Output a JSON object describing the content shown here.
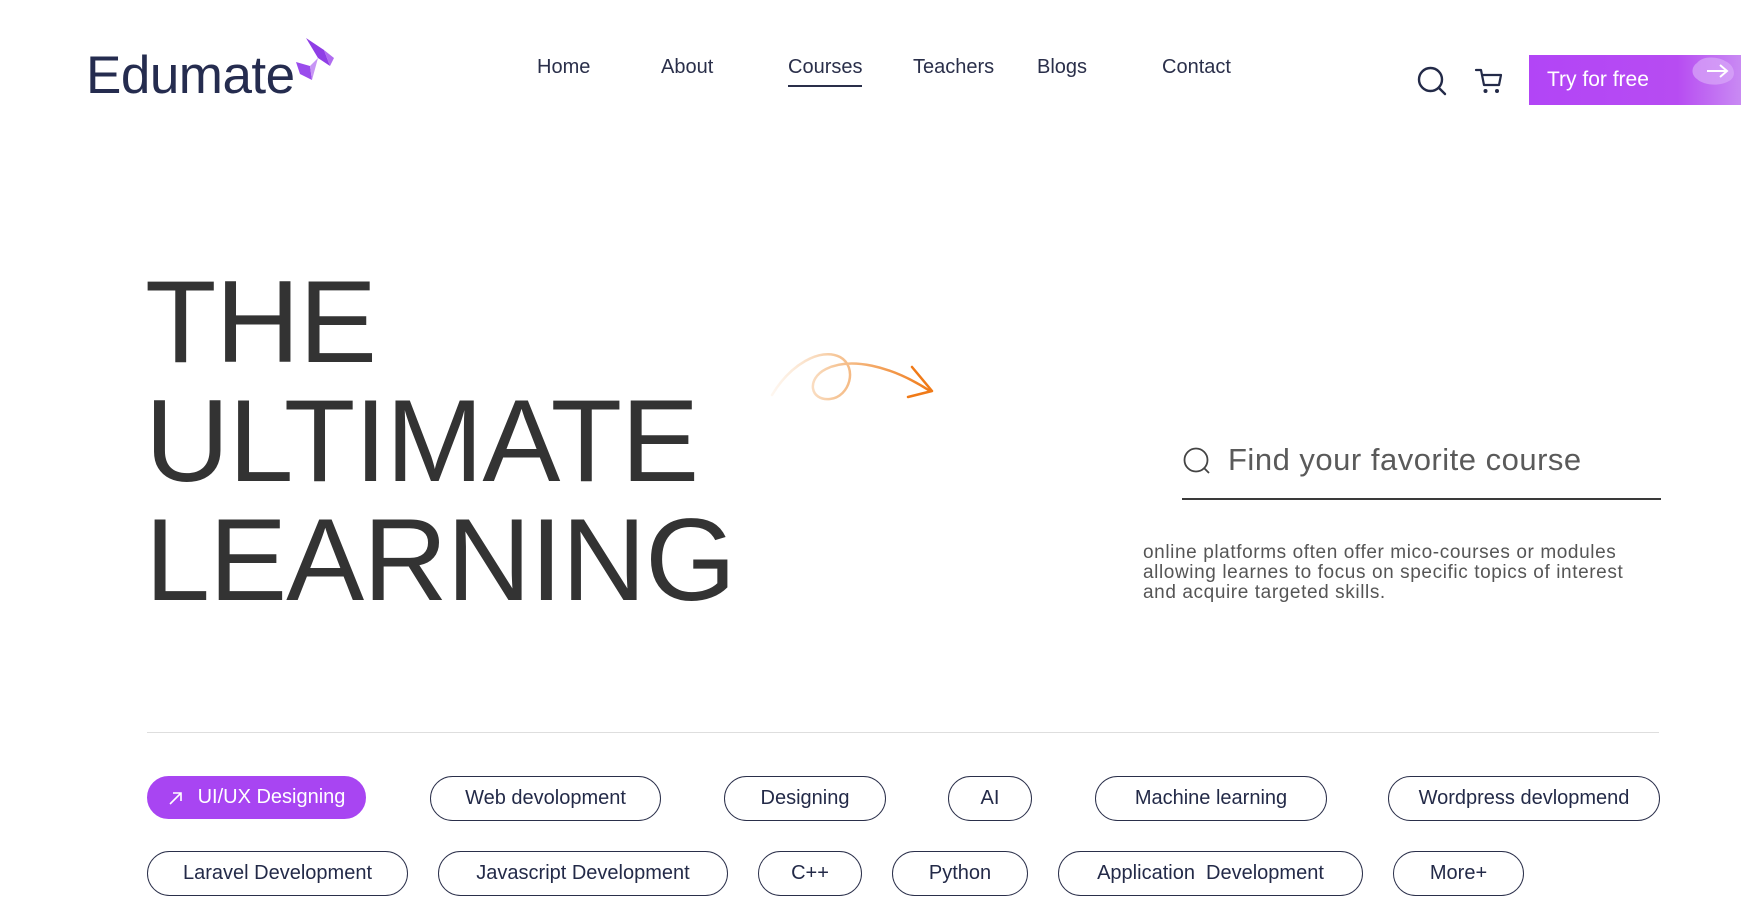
{
  "brand": {
    "name": "Edumate",
    "primary_color": "#a845f2",
    "accent_orange": "#f07a18",
    "text_color": "#252c4f"
  },
  "nav": {
    "items": [
      {
        "label": "Home"
      },
      {
        "label": "About"
      },
      {
        "label": "Courses",
        "active": true
      },
      {
        "label": "Teachers"
      },
      {
        "label": "Blogs"
      },
      {
        "label": "Contact"
      }
    ]
  },
  "header_actions": {
    "search_icon": "search-icon",
    "cart_icon": "cart-icon",
    "cta_label": "Try for free",
    "cta_icon": "arrow-right-icon"
  },
  "hero": {
    "title_lines": [
      "THE",
      "ULTIMATE",
      "LEARNING"
    ],
    "decoration_icon": "swirl-arrow-icon",
    "search_placeholder": "Find your favorite course",
    "description_lines": [
      "online platforms often offer mico-courses or modules",
      "allowing learnes to focus on specific topics of interest",
      "and acquire targeted skills."
    ]
  },
  "categories": {
    "row1": [
      {
        "label": "UI/UX Designing",
        "active": true
      },
      {
        "label": "Web devolopment"
      },
      {
        "label": "Designing"
      },
      {
        "label": "AI"
      },
      {
        "label": "Machine learning"
      },
      {
        "label": "Wordpress devlopmend"
      }
    ],
    "row2": [
      {
        "label": "Laravel Development"
      },
      {
        "label": "Javascript Development"
      },
      {
        "label": "C++"
      },
      {
        "label": "Python"
      },
      {
        "label": "Application  Development"
      },
      {
        "label": "More+"
      }
    ]
  }
}
